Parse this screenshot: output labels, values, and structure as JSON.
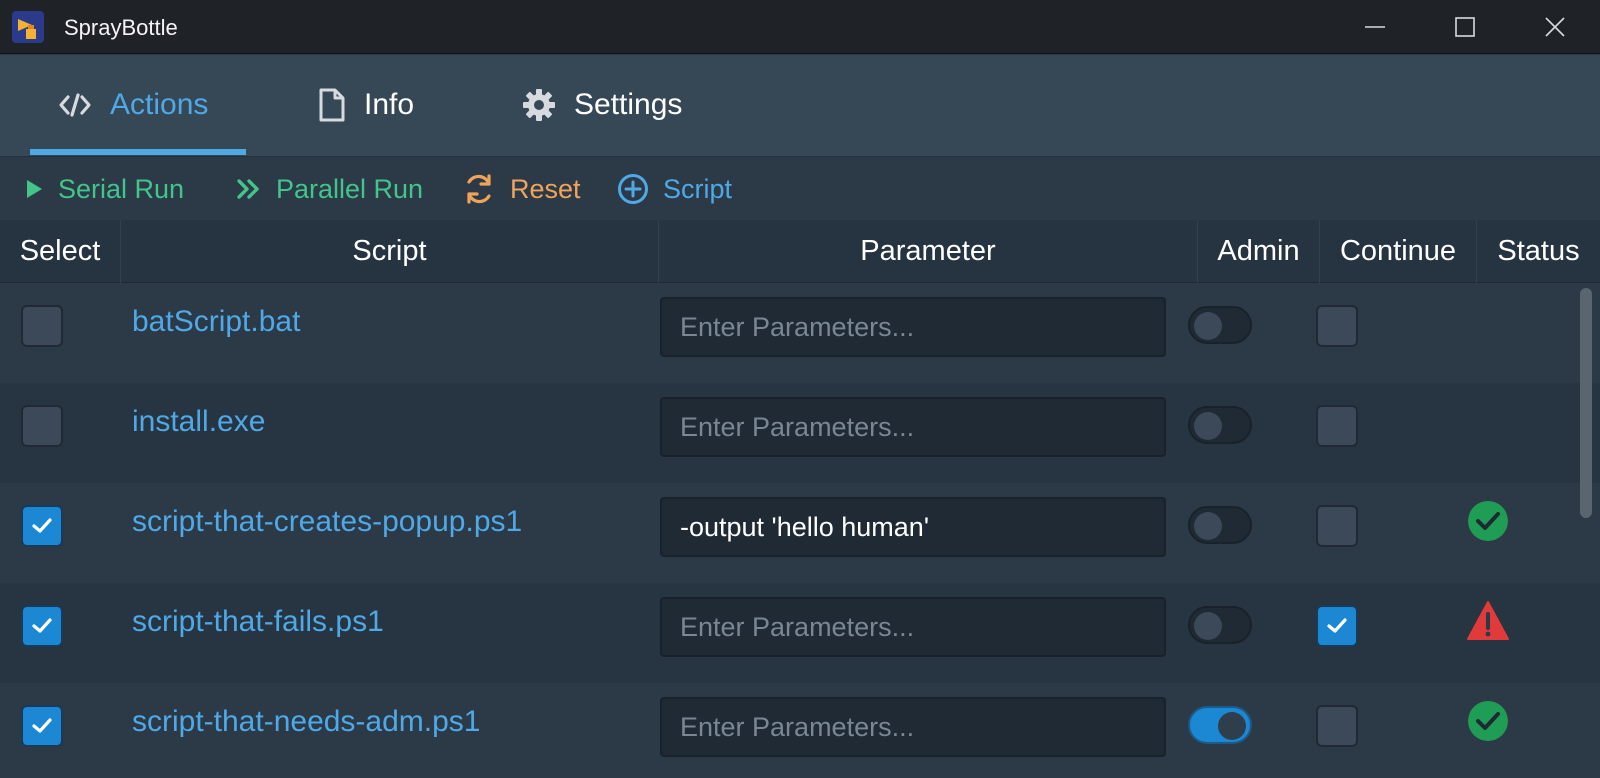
{
  "window": {
    "title": "SprayBottle",
    "controls": [
      "minimize-icon",
      "maximize-icon",
      "close-icon"
    ]
  },
  "tabs": [
    {
      "label": "Actions",
      "icon": "code-icon",
      "active": true
    },
    {
      "label": "Info",
      "icon": "file-icon",
      "active": false
    },
    {
      "label": "Settings",
      "icon": "gear-icon",
      "active": false
    }
  ],
  "toolbar": {
    "serial_run": "Serial Run",
    "parallel_run": "Parallel Run",
    "reset": "Reset",
    "script": "Script"
  },
  "table": {
    "columns": [
      "Select",
      "Script",
      "Parameter",
      "Admin",
      "Continue",
      "Status"
    ],
    "rows": [
      {
        "selected": false,
        "script": "batScript.bat",
        "parameter": "",
        "placeholder": "Enter Parameters...",
        "admin": false,
        "continue": false,
        "status": ""
      },
      {
        "selected": false,
        "script": "install.exe",
        "parameter": "",
        "placeholder": "Enter Parameters...",
        "admin": false,
        "continue": false,
        "status": ""
      },
      {
        "selected": true,
        "script": "script-that-creates-popup.ps1",
        "parameter": "-output 'hello human'",
        "placeholder": "Enter Parameters...",
        "admin": false,
        "continue": false,
        "status": "success"
      },
      {
        "selected": true,
        "script": "script-that-fails.ps1",
        "parameter": "",
        "placeholder": "Enter Parameters...",
        "admin": false,
        "continue": true,
        "status": "error"
      },
      {
        "selected": true,
        "script": "script-that-needs-adm.ps1",
        "parameter": "",
        "placeholder": "Enter Parameters...",
        "admin": true,
        "continue": false,
        "status": "success"
      }
    ]
  },
  "colors": {
    "accent": "#4ea9e6",
    "run_green": "#42c48b",
    "reset_orange": "#f0a45a",
    "success": "#1f9d55",
    "error": "#e03a3a"
  }
}
